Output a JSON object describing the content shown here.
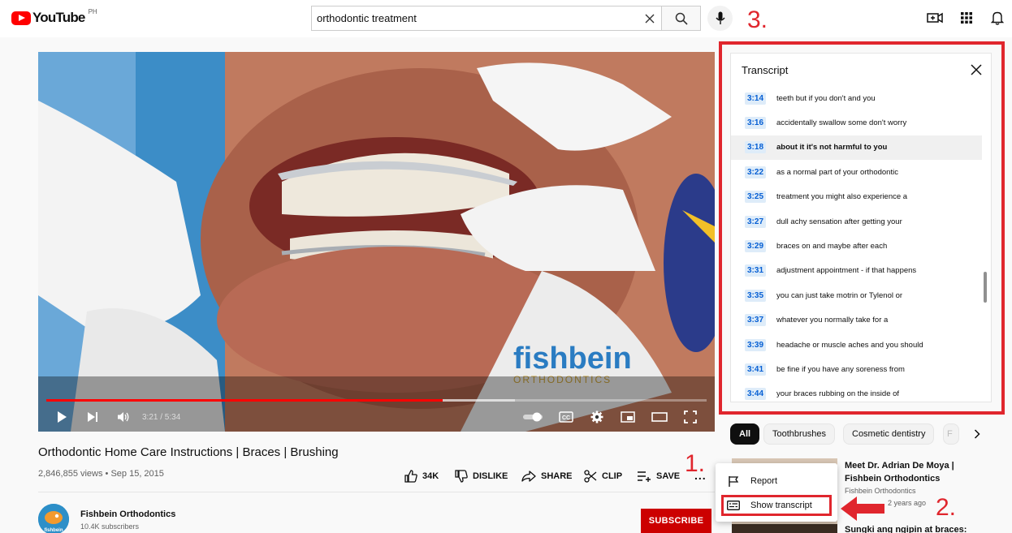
{
  "header": {
    "logo_text": "YouTube",
    "country": "PH",
    "search_value": "orthodontic treatment"
  },
  "annotations": {
    "step1": "1.",
    "step2": "2.",
    "step3": "3."
  },
  "player": {
    "current_time": "3:21",
    "duration": "5:34",
    "time_display": "3:21 / 5:34",
    "progress_fraction": 0.6,
    "buffered_fraction": 0.71,
    "watermark_brand": "fishbein",
    "watermark_sub": "ORTHODONTICS"
  },
  "video": {
    "title": "Orthodontic Home Care Instructions | Braces | Brushing",
    "meta": "2,846,855 views • Sep 15, 2015",
    "actions": {
      "like": "34K",
      "dislike": "DISLIKE",
      "share": "SHARE",
      "clip": "CLIP",
      "save": "SAVE"
    },
    "more": "..."
  },
  "channel": {
    "name": "Fishbein Orthodontics",
    "subscribers": "10.4K subscribers",
    "subscribe_label": "SUBSCRIBE",
    "avatar_text": "fishbein"
  },
  "transcript": {
    "title": "Transcript",
    "segments": [
      {
        "time": "3:14",
        "text": "teeth but if you don't and you"
      },
      {
        "time": "3:16",
        "text": "accidentally swallow some don't worry"
      },
      {
        "time": "3:18",
        "text": "about it it's not harmful to you"
      },
      {
        "time": "3:22",
        "text": "as a normal part of your orthodontic"
      },
      {
        "time": "3:25",
        "text": "treatment you might also experience a"
      },
      {
        "time": "3:27",
        "text": "dull achy sensation after getting your"
      },
      {
        "time": "3:29",
        "text": "braces on and maybe after each"
      },
      {
        "time": "3:31",
        "text": "adjustment appointment - if that happens"
      },
      {
        "time": "3:35",
        "text": "you can just take motrin or Tylenol or"
      },
      {
        "time": "3:37",
        "text": "whatever you normally take for a"
      },
      {
        "time": "3:39",
        "text": "headache or muscle aches and you should"
      },
      {
        "time": "3:41",
        "text": "be fine if you have any soreness from"
      },
      {
        "time": "3:44",
        "text": "your braces rubbing on the inside of"
      }
    ],
    "active_index": 2
  },
  "chips": [
    "All",
    "Toothbrushes",
    "Cosmetic dentistry",
    "F"
  ],
  "menu": {
    "report": "Report",
    "show_transcript": "Show transcript"
  },
  "recommendations": [
    {
      "title": "Meet Dr. Adrian De Moya | Fishbein Orthodontics",
      "channel": "Fishbein Orthodontics",
      "age": "2 years ago"
    },
    {
      "title": "Sungki ang ngipin at braces:"
    }
  ],
  "colors": {
    "brand_red": "#ff0000",
    "annotation_red": "#e0262d",
    "timestamp_blue": "#065fd4",
    "subscribe_red": "#cc0000"
  }
}
